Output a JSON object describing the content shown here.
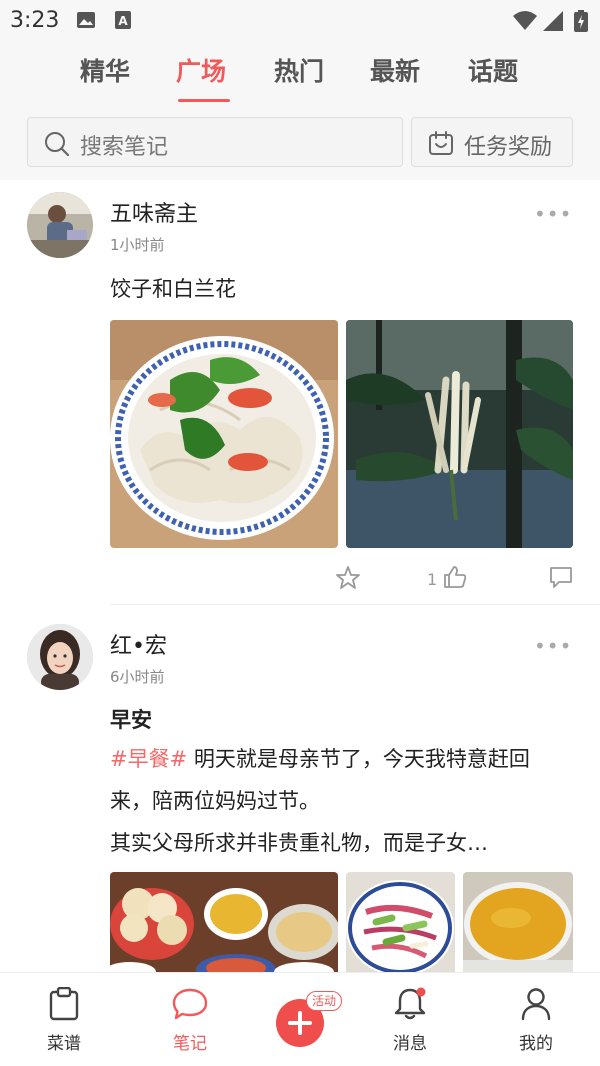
{
  "status_bar": {
    "time": "3:23",
    "icons": [
      "image-icon",
      "a-notification-icon",
      "wifi-icon",
      "signal-icon",
      "battery-charging-icon"
    ]
  },
  "tabs": [
    {
      "label": "精华",
      "active": false
    },
    {
      "label": "广场",
      "active": true
    },
    {
      "label": "热门",
      "active": false
    },
    {
      "label": "最新",
      "active": false
    },
    {
      "label": "话题",
      "active": false
    }
  ],
  "search": {
    "placeholder": "搜索笔记",
    "icon": "search-icon"
  },
  "task_button": {
    "label": "任务奖励",
    "icon": "gift-calendar-icon"
  },
  "posts": [
    {
      "author": "五味斋主",
      "time": "1小时前",
      "text": "饺子和白兰花",
      "images": [
        "dumplings-photo",
        "white-orchid-flower-photo"
      ],
      "likes": "1"
    },
    {
      "author": "红•宏",
      "time": "6小时前",
      "title": "早安",
      "hashtag": "#早餐#",
      "text_line1": "明天就是母亲节了，今天我特意赶回",
      "text_line2": "来，陪两位妈妈过节。",
      "text_line3": "其实父母所求并非贵重礼物，而是子女…",
      "images": [
        "breakfast-table-photo",
        "salad-plate-photo",
        "millet-porridge-photo"
      ]
    }
  ],
  "bottom_nav": [
    {
      "label": "菜谱",
      "icon": "clipboard-icon",
      "active": false
    },
    {
      "label": "笔记",
      "icon": "chat-bubble-icon",
      "active": true
    },
    {
      "label": "",
      "icon": "add-icon",
      "active": false
    },
    {
      "label": "消息",
      "icon": "bell-icon",
      "active": false
    },
    {
      "label": "我的",
      "icon": "person-icon",
      "active": false
    }
  ],
  "add_badge": "活动",
  "colors": {
    "accent": "#f25a5a",
    "hashtag": "#f26a6a",
    "muted": "#888888",
    "background_top": "#f7f7f7"
  }
}
